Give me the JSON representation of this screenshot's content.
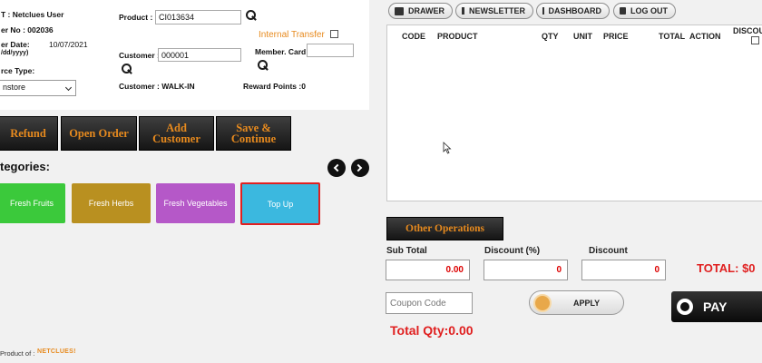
{
  "header": {
    "user_label": "T : Netclues User",
    "order_no": "er No : 002036",
    "order_date_label": "er Date:",
    "date_format": "/dd/yyyy)",
    "order_date": "10/07/2021",
    "source_type_label": "rce Type:",
    "source_type_value": "nstore",
    "product_label": "Product :",
    "product_value": "CI013634",
    "internal_transfer_label": "Internal Transfer",
    "customer_label": "Customer :",
    "customer_value": "000001",
    "member_card_label": "Member. Card:",
    "member_card_value": "",
    "customer_name": "Customer : WALK-IN",
    "reward_points": "Reward Points :0"
  },
  "actions": {
    "refund": "Refund",
    "open_order": "Open Order",
    "add_customer_1": "Add",
    "add_customer_2": "Customer",
    "save_continue_1": "Save &",
    "save_continue_2": "Continue"
  },
  "categories": {
    "heading": "tegories:",
    "items": [
      {
        "label": "Fresh Fruits",
        "color": "#3bc93b"
      },
      {
        "label": "Fresh Herbs",
        "color": "#b99020"
      },
      {
        "label": "Fresh Vegetables",
        "color": "#b558c8"
      },
      {
        "label": "Top Up",
        "color": "#3bb8df"
      }
    ],
    "selected_border": "#e02020"
  },
  "footer": {
    "product_of": "Product of :",
    "brand": "NETCLUES!"
  },
  "top_nav": {
    "drawer": "DRAWER",
    "newsletter": "NEWSLETTER",
    "dashboard": "DASHBOARD",
    "logout": "LOG OUT"
  },
  "table": {
    "columns": [
      "CODE",
      "PRODUCT",
      "QTY",
      "UNIT",
      "PRICE",
      "TOTAL",
      "ACTION",
      "DISCOU"
    ]
  },
  "totals": {
    "other_operations": "Other Operations",
    "sub_total_label": "Sub Total",
    "sub_total_value": "0.00",
    "discount_pct_label": "Discount (%)",
    "discount_pct_value": "0",
    "discount_label": "Discount",
    "discount_value": "0",
    "total": "TOTAL: $0",
    "coupon_placeholder": "Coupon Code",
    "apply": "APPLY",
    "pay": "PAY",
    "total_qty": "Total Qty:0.00"
  }
}
